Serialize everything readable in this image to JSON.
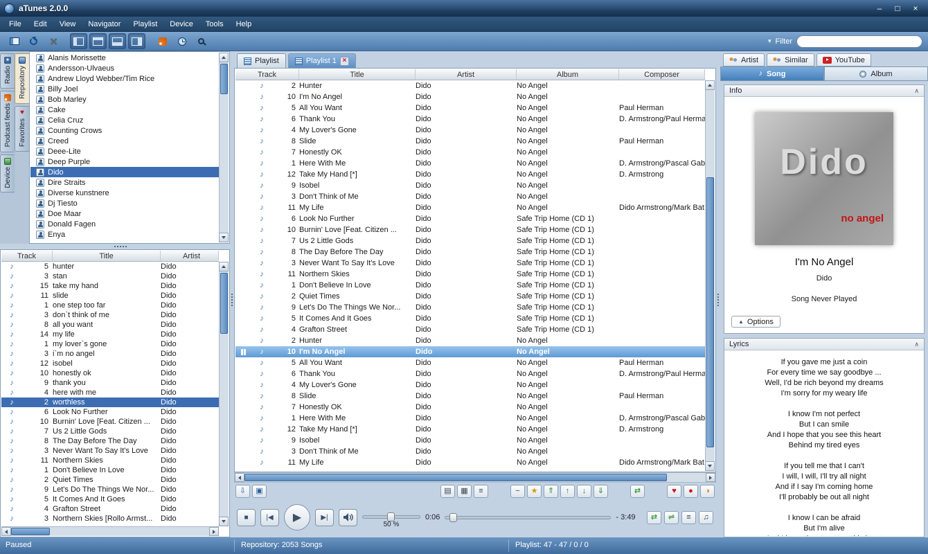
{
  "window": {
    "title": "aTunes 2.0.0"
  },
  "icons": {
    "minimize": "–",
    "maximize": "□",
    "close": "×",
    "filter_caret": "▾",
    "note": "♪",
    "chevron_up": "∧",
    "heart": "♥",
    "stop": "■",
    "play": "▶",
    "prev": "|◀",
    "next": "▶|",
    "tab_close": "×",
    "options_arrow": "▲"
  },
  "menu": {
    "items": [
      "File",
      "Edit",
      "View",
      "Navigator",
      "Playlist",
      "Device",
      "Tools",
      "Help"
    ]
  },
  "toolbar": {
    "filter_label": "Filter",
    "search_value": ""
  },
  "nav_tabs": {
    "col1": [
      {
        "label": "Radio"
      },
      {
        "label": "Podcast feeds"
      },
      {
        "label": "Device"
      }
    ],
    "col2": [
      {
        "label": "Repository",
        "selected": true
      },
      {
        "label": "Favorites",
        "heart": true
      }
    ]
  },
  "artist_tree": {
    "selected": "Dido",
    "items": [
      "Alanis Morissette",
      "Andersson-Ulvaeus",
      "Andrew Lloyd Webber/Tim Rice",
      "Billy Joel",
      "Bob Marley",
      "Cake",
      "Celia Cruz",
      "Counting Crows",
      "Creed",
      "Deee-Lite",
      "Deep Purple",
      "Dido",
      "Dire Straits",
      "Diverse kunstnere",
      "Dj Tiesto",
      "Doe Maar",
      "Donald Fagen",
      "Enya"
    ]
  },
  "left_table": {
    "columns": [
      "Track",
      "Title",
      "Artist"
    ],
    "selected_index": 14,
    "rows": [
      [
        5,
        "hunter",
        "Dido"
      ],
      [
        3,
        "stan",
        "Dido"
      ],
      [
        15,
        "take my hand",
        "Dido"
      ],
      [
        11,
        "slide",
        "Dido"
      ],
      [
        1,
        "one step too far",
        "Dido"
      ],
      [
        3,
        "don`t think of me",
        "Dido"
      ],
      [
        8,
        "all you want",
        "Dido"
      ],
      [
        14,
        "my life",
        "Dido"
      ],
      [
        1,
        "my lover`s gone",
        "Dido"
      ],
      [
        3,
        "i`m no angel",
        "Dido"
      ],
      [
        12,
        "isobel",
        "Dido"
      ],
      [
        10,
        "honestly ok",
        "Dido"
      ],
      [
        9,
        "thank you",
        "Dido"
      ],
      [
        4,
        "here with me",
        "Dido"
      ],
      [
        2,
        "worthless",
        "Dido"
      ],
      [
        6,
        "Look No Further",
        "Dido"
      ],
      [
        10,
        "Burnin' Love [Feat. Citizen ...",
        "Dido"
      ],
      [
        7,
        "Us 2 Little Gods",
        "Dido"
      ],
      [
        8,
        "The Day Before The Day",
        "Dido"
      ],
      [
        3,
        "Never Want To Say It's Love",
        "Dido"
      ],
      [
        11,
        "Northern Skies",
        "Dido"
      ],
      [
        1,
        "Don't Believe In Love",
        "Dido"
      ],
      [
        2,
        "Quiet Times",
        "Dido"
      ],
      [
        9,
        "Let's Do The Things We Nor...",
        "Dido"
      ],
      [
        5,
        "It Comes And It Goes",
        "Dido"
      ],
      [
        4,
        "Grafton Street",
        "Dido"
      ],
      [
        3,
        "Northern Skies [Rollo Armst...",
        "Dido"
      ]
    ]
  },
  "playlist_tabs": {
    "tabs": [
      {
        "label": "Playlist"
      },
      {
        "label": "Playlist 1",
        "active": true,
        "closable": true
      }
    ]
  },
  "playlist_table": {
    "columns": [
      "Track",
      "Title",
      "Artist",
      "Album",
      "Composer"
    ],
    "playing_index": 24,
    "rows": [
      [
        2,
        "Hunter",
        "Dido",
        "No Angel",
        ""
      ],
      [
        10,
        "I'm No Angel",
        "Dido",
        "No Angel",
        ""
      ],
      [
        5,
        "All You Want",
        "Dido",
        "No Angel",
        "Paul Herman"
      ],
      [
        6,
        "Thank You",
        "Dido",
        "No Angel",
        "D. Armstrong/Paul Herma"
      ],
      [
        4,
        "My Lover's Gone",
        "Dido",
        "No Angel",
        ""
      ],
      [
        8,
        "Slide",
        "Dido",
        "No Angel",
        "Paul Herman"
      ],
      [
        7,
        "Honestly OK",
        "Dido",
        "No Angel",
        ""
      ],
      [
        1,
        "Here With Me",
        "Dido",
        "No Angel",
        "D. Armstrong/Pascal Gab"
      ],
      [
        12,
        "Take My Hand [*]",
        "Dido",
        "No Angel",
        "D. Armstrong"
      ],
      [
        9,
        "Isobel",
        "Dido",
        "No Angel",
        ""
      ],
      [
        3,
        "Don't Think of Me",
        "Dido",
        "No Angel",
        ""
      ],
      [
        11,
        "My Life",
        "Dido",
        "No Angel",
        "Dido Armstrong/Mark Bat"
      ],
      [
        6,
        "Look No Further",
        "Dido",
        "Safe Trip Home (CD 1)",
        ""
      ],
      [
        10,
        "Burnin' Love [Feat. Citizen ...",
        "Dido",
        "Safe Trip Home (CD 1)",
        ""
      ],
      [
        7,
        "Us 2 Little Gods",
        "Dido",
        "Safe Trip Home (CD 1)",
        ""
      ],
      [
        8,
        "The Day Before The Day",
        "Dido",
        "Safe Trip Home (CD 1)",
        ""
      ],
      [
        3,
        "Never Want To Say It's Love",
        "Dido",
        "Safe Trip Home (CD 1)",
        ""
      ],
      [
        11,
        "Northern Skies",
        "Dido",
        "Safe Trip Home (CD 1)",
        ""
      ],
      [
        1,
        "Don't Believe In Love",
        "Dido",
        "Safe Trip Home (CD 1)",
        ""
      ],
      [
        2,
        "Quiet Times",
        "Dido",
        "Safe Trip Home (CD 1)",
        ""
      ],
      [
        9,
        "Let's Do The Things We Nor...",
        "Dido",
        "Safe Trip Home (CD 1)",
        ""
      ],
      [
        5,
        "It Comes And It Goes",
        "Dido",
        "Safe Trip Home (CD 1)",
        ""
      ],
      [
        4,
        "Grafton Street",
        "Dido",
        "Safe Trip Home (CD 1)",
        ""
      ],
      [
        2,
        "Hunter",
        "Dido",
        "No Angel",
        ""
      ],
      [
        10,
        "I'm No Angel",
        "Dido",
        "No Angel",
        ""
      ],
      [
        5,
        "All You Want",
        "Dido",
        "No Angel",
        "Paul Herman"
      ],
      [
        6,
        "Thank You",
        "Dido",
        "No Angel",
        "D. Armstrong/Paul Herma"
      ],
      [
        4,
        "My Lover's Gone",
        "Dido",
        "No Angel",
        ""
      ],
      [
        8,
        "Slide",
        "Dido",
        "No Angel",
        "Paul Herman"
      ],
      [
        7,
        "Honestly OK",
        "Dido",
        "No Angel",
        ""
      ],
      [
        1,
        "Here With Me",
        "Dido",
        "No Angel",
        "D. Armstrong/Pascal Gab"
      ],
      [
        12,
        "Take My Hand [*]",
        "Dido",
        "No Angel",
        "D. Armstrong"
      ],
      [
        9,
        "Isobel",
        "Dido",
        "No Angel",
        ""
      ],
      [
        3,
        "Don't Think of Me",
        "Dido",
        "No Angel",
        ""
      ],
      [
        11,
        "My Life",
        "Dido",
        "No Angel",
        "Dido Armstrong/Mark Bat"
      ]
    ]
  },
  "playlist_buttons": {
    "left": [
      {
        "name": "scroll-to-playing",
        "glyph": "⇩",
        "cls": "blue"
      },
      {
        "name": "playlist-selector",
        "glyph": "▣",
        "cls": "blue"
      }
    ],
    "group1": [
      {
        "name": "show-cover",
        "glyph": "▤"
      },
      {
        "name": "show-artist-info",
        "glyph": "▦"
      },
      {
        "name": "show-properties",
        "glyph": "≡"
      }
    ],
    "group2": [
      {
        "name": "remove-song",
        "glyph": "−"
      },
      {
        "name": "favorite-star",
        "glyph": "★",
        "cls": "gold"
      },
      {
        "name": "move-to-top",
        "glyph": "⇑",
        "cls": "green"
      },
      {
        "name": "move-up",
        "glyph": "↑",
        "cls": "green"
      },
      {
        "name": "move-down",
        "glyph": "↓",
        "cls": "green"
      },
      {
        "name": "move-to-bottom",
        "glyph": "⇓",
        "cls": "green"
      }
    ],
    "group3": [
      {
        "name": "shuffle-playlist",
        "glyph": "⇄",
        "cls": "green"
      }
    ],
    "group4": [
      {
        "name": "favorite-heart",
        "glyph": "♥",
        "cls": "red"
      },
      {
        "name": "love-song",
        "glyph": "●",
        "cls": "red"
      },
      {
        "name": "love-album",
        "glyph": "◑",
        "cls": "orange"
      }
    ]
  },
  "player": {
    "elapsed": "0:06",
    "remaining": "- 3:49",
    "volume_label": "50 %",
    "volume_percent": 50,
    "progress_percent": 3,
    "extra_buttons": [
      {
        "name": "repeat",
        "glyph": "⇄",
        "cls": "green"
      },
      {
        "name": "shuffle",
        "glyph": "⇌",
        "cls": "green"
      },
      {
        "name": "show-playlist-view",
        "glyph": "≡"
      },
      {
        "name": "visualizer",
        "glyph": "♫"
      }
    ]
  },
  "right_panel": {
    "tabs_top": [
      "Artist",
      "Similar",
      "YouTube"
    ],
    "tabs_mid": [
      {
        "label": "Song",
        "active": true
      },
      {
        "label": "Album"
      }
    ],
    "info": {
      "title": "Info",
      "art_title": "Dido",
      "art_subtitle": "no angel",
      "song": "I'm No Angel",
      "artist": "Dido",
      "play_status": "Song Never Played",
      "options_label": "Options"
    },
    "lyrics": {
      "title": "Lyrics",
      "lines": [
        "If you gave me just a coin",
        "For every time we say goodbye ...",
        "Well, I'd be rich beyond my dreams",
        "I'm sorry for my weary life",
        "",
        "I know I'm not perfect",
        "But I can smile",
        "And I hope that you see this heart",
        "Behind my tired eyes",
        "",
        "If you tell me that I can't",
        "I will, I will, I'll try all night",
        "And if I say I'm coming home",
        "I'll probably be out all night",
        "",
        "I know I can be afraid",
        "But I'm alive",
        "And I hope that you treat this heart"
      ]
    }
  },
  "statusbar": {
    "state": "Paused",
    "repository": "Repository: 2053 Songs",
    "playlist": "Playlist: 47 - 47 / 0 / 0"
  }
}
